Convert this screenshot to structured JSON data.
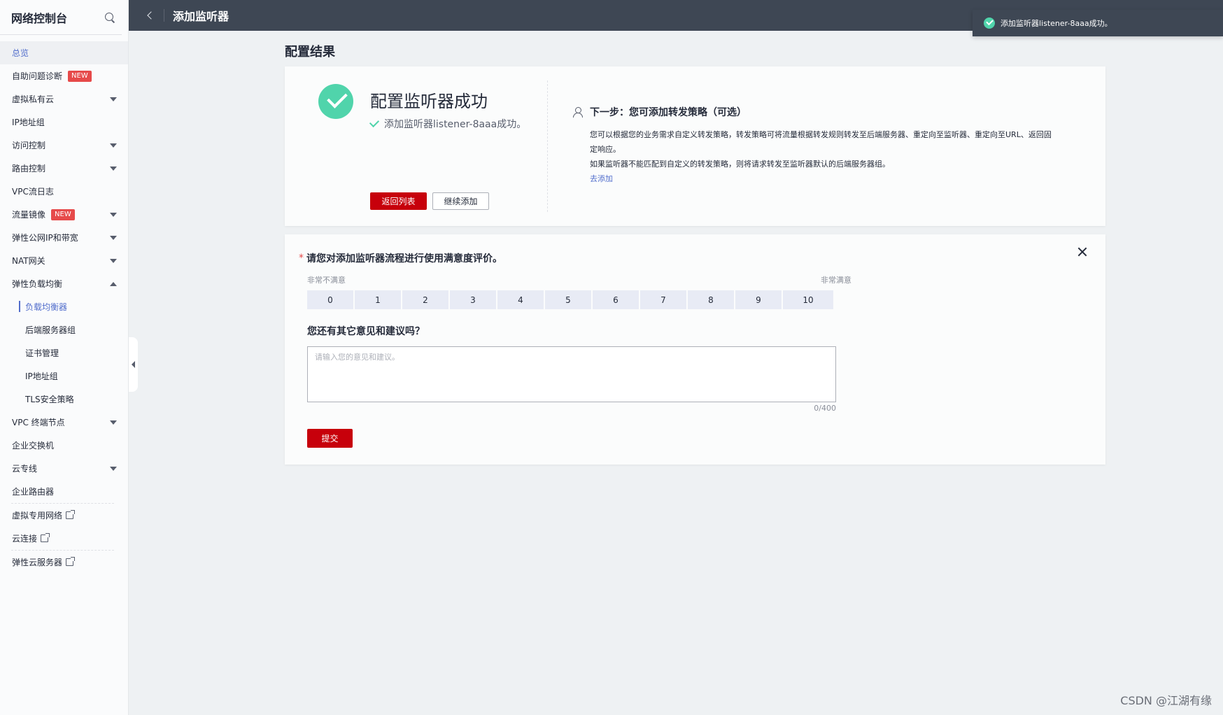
{
  "sidebar": {
    "title": "网络控制台",
    "items": [
      {
        "label": "总览"
      },
      {
        "label": "自助问题诊断",
        "badge": "NEW"
      },
      {
        "label": "虚拟私有云"
      },
      {
        "label": "IP地址组"
      },
      {
        "label": "访问控制"
      },
      {
        "label": "路由控制"
      },
      {
        "label": "VPC流日志"
      },
      {
        "label": "流量镜像",
        "badge": "NEW"
      },
      {
        "label": "弹性公网IP和带宽"
      },
      {
        "label": "NAT网关"
      },
      {
        "label": "弹性负载均衡"
      },
      {
        "label": "负载均衡器"
      },
      {
        "label": "后端服务器组"
      },
      {
        "label": "证书管理"
      },
      {
        "label": "IP地址组"
      },
      {
        "label": "TLS安全策略"
      },
      {
        "label": "VPC 终端节点"
      },
      {
        "label": "企业交换机"
      },
      {
        "label": "云专线"
      },
      {
        "label": "企业路由器"
      },
      {
        "label": "虚拟专用网络"
      },
      {
        "label": "云连接"
      },
      {
        "label": "弹性云服务器"
      }
    ]
  },
  "topbar": {
    "title": "添加监听器"
  },
  "toast": {
    "message": "添加监听器listener-8aaa成功。"
  },
  "page": {
    "title": "配置结果"
  },
  "result": {
    "title": "配置监听器成功",
    "subtitle": "添加监听器listener-8aaa成功。",
    "btn_back": "返回列表",
    "btn_continue": "继续添加",
    "next_title": "下一步：您可添加转发策略（可选）",
    "next_line1": "您可以根据您的业务需求自定义转发策略，转发策略可将流量根据转发规则转发至后端服务器、重定向至监听器、重定向至URL、返回固定响应。",
    "next_line2": "如果监听器不能匹配到自定义的转发策略，则将请求转发至监听器默认的后端服务器组。",
    "next_link": "去添加"
  },
  "survey": {
    "question": "请您对添加监听器流程进行使用满意度评价。",
    "low_label": "非常不满意",
    "high_label": "非常满意",
    "scale": [
      "0",
      "1",
      "2",
      "3",
      "4",
      "5",
      "6",
      "7",
      "8",
      "9",
      "10"
    ],
    "question2": "您还有其它意见和建议吗？",
    "placeholder": "请输入您的意见和建议。",
    "counter": "0/400",
    "submit": "提交"
  },
  "watermark": "CSDN @江湖有缘",
  "colors": {
    "accent": "#c7000b",
    "success": "#50d4ab",
    "link": "#526ecc",
    "topbar": "#3e4754"
  }
}
